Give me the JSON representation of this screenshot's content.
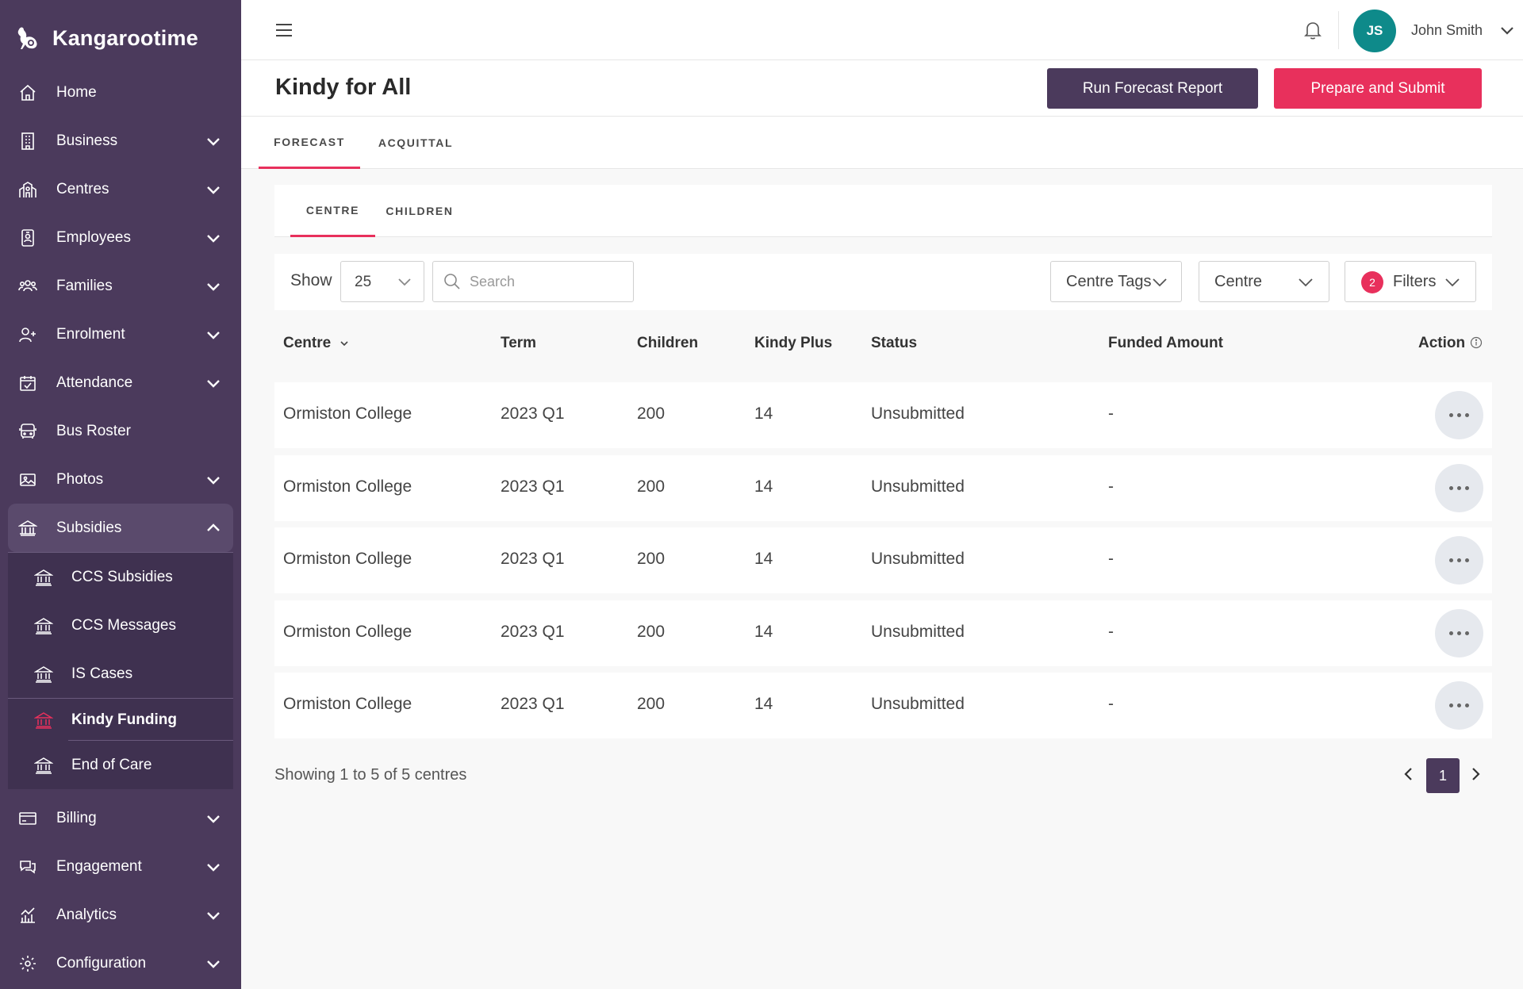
{
  "app": {
    "name": "Kangarootime"
  },
  "sidebar": {
    "items": [
      {
        "label": "Home",
        "icon": "home-icon"
      },
      {
        "label": "Business",
        "icon": "building-icon"
      },
      {
        "label": "Centres",
        "icon": "centres-icon"
      },
      {
        "label": "Employees",
        "icon": "badge-icon"
      },
      {
        "label": "Families",
        "icon": "family-icon"
      },
      {
        "label": "Enrolment",
        "icon": "add-user-icon"
      },
      {
        "label": "Attendance",
        "icon": "calendar-check-icon"
      },
      {
        "label": "Bus Roster",
        "icon": "bus-icon"
      },
      {
        "label": "Photos",
        "icon": "photos-icon"
      },
      {
        "label": "Subsidies",
        "icon": "bank-icon"
      },
      {
        "label": "Billing",
        "icon": "credit-card-icon"
      },
      {
        "label": "Engagement",
        "icon": "chat-icon"
      },
      {
        "label": "Analytics",
        "icon": "analytics-icon"
      },
      {
        "label": "Configuration",
        "icon": "gear-icon"
      }
    ],
    "subsidies_sub": [
      {
        "label": "CCS Subsidies"
      },
      {
        "label": "CCS Messages"
      },
      {
        "label": "IS Cases"
      },
      {
        "label": "Kindy Funding"
      },
      {
        "label": "End of Care"
      }
    ],
    "accent_color": "#e8305c",
    "bg_color": "#4b3a5c"
  },
  "topbar": {
    "user_initials": "JS",
    "user_name": "John Smith",
    "avatar_color": "#0e8a8a"
  },
  "page": {
    "title": "Kindy for All",
    "run_report_label": "Run Forecast Report",
    "submit_label": "Prepare and Submit"
  },
  "tabs": {
    "main": [
      "FORECAST",
      "ACQUITTAL"
    ],
    "sub": [
      "CENTRE",
      "CHILDREN"
    ]
  },
  "filters": {
    "show_label": "Show",
    "page_size": "25",
    "search_placeholder": "Search",
    "centre_tags_label": "Centre Tags",
    "centre_label": "Centre",
    "filters_label": "Filters",
    "filters_count": "2"
  },
  "table": {
    "columns": [
      "Centre",
      "Term",
      "Children",
      "Kindy Plus",
      "Status",
      "Funded Amount",
      "Action"
    ],
    "rows": [
      {
        "centre": "Ormiston College",
        "term": "2023 Q1",
        "children": "200",
        "kindy_plus": "14",
        "status": "Unsubmitted",
        "funded": "-"
      },
      {
        "centre": "Ormiston College",
        "term": "2023 Q1",
        "children": "200",
        "kindy_plus": "14",
        "status": "Unsubmitted",
        "funded": "-"
      },
      {
        "centre": "Ormiston College",
        "term": "2023 Q1",
        "children": "200",
        "kindy_plus": "14",
        "status": "Unsubmitted",
        "funded": "-"
      },
      {
        "centre": "Ormiston College",
        "term": "2023 Q1",
        "children": "200",
        "kindy_plus": "14",
        "status": "Unsubmitted",
        "funded": "-"
      },
      {
        "centre": "Ormiston College",
        "term": "2023 Q1",
        "children": "200",
        "kindy_plus": "14",
        "status": "Unsubmitted",
        "funded": "-"
      }
    ]
  },
  "pagination": {
    "summary": "Showing 1 to 5 of 5 centres",
    "current_page": "1"
  }
}
